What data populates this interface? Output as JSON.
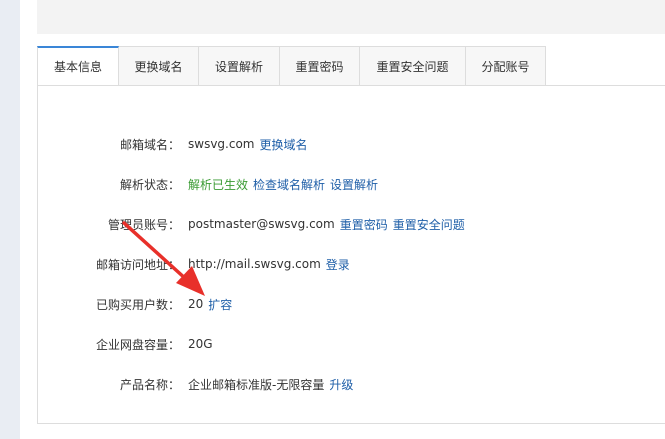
{
  "tabs": [
    {
      "label": "基本信息",
      "active": true
    },
    {
      "label": "更换域名",
      "active": false
    },
    {
      "label": "设置解析",
      "active": false
    },
    {
      "label": "重置密码",
      "active": false
    },
    {
      "label": "重置安全问题",
      "active": false
    },
    {
      "label": "分配账号",
      "active": false
    }
  ],
  "info": {
    "domain": {
      "label": "邮箱域名：",
      "value": "swsvg.com",
      "link": "更换域名"
    },
    "status": {
      "label": "解析状态：",
      "value": "解析已生效",
      "link1": "检查域名解析",
      "link2": "设置解析"
    },
    "admin": {
      "label": "管理员账号：",
      "value": "postmaster@swsvg.com",
      "link1": "重置密码",
      "link2": "重置安全问题"
    },
    "access": {
      "label": "邮箱访问地址：",
      "value": "http://mail.swsvg.com",
      "link": "登录"
    },
    "users": {
      "label": "已购买用户数：",
      "value": "20",
      "link": "扩容"
    },
    "disk": {
      "label": "企业网盘容量：",
      "value": "20G"
    },
    "product": {
      "label": "产品名称：",
      "value": "企业邮箱标准版-无限容量",
      "link": "升级"
    }
  },
  "colors": {
    "link": "#1f5fa8",
    "status_ok": "#3a9b33",
    "annotation_arrow": "#e8302a",
    "active_tab": "#3a86d7"
  }
}
